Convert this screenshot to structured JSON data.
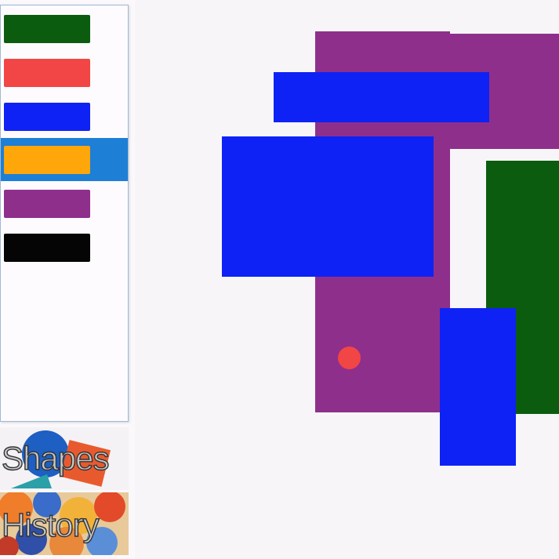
{
  "palette": {
    "swatches": [
      {
        "color": "#0b5c0f",
        "selected": false
      },
      {
        "color": "#f24545",
        "selected": false
      },
      {
        "color": "#0e22f5",
        "selected": false
      },
      {
        "color": "#ffa60a",
        "selected": true
      },
      {
        "color": "#8e2f8c",
        "selected": false
      },
      {
        "color": "#050505",
        "selected": false
      }
    ],
    "selected_highlight": "#1e7fd6"
  },
  "nav": {
    "shapes_label": "Shapes",
    "history_label": "History"
  },
  "canvas": {
    "background": "#f7f5f8"
  }
}
